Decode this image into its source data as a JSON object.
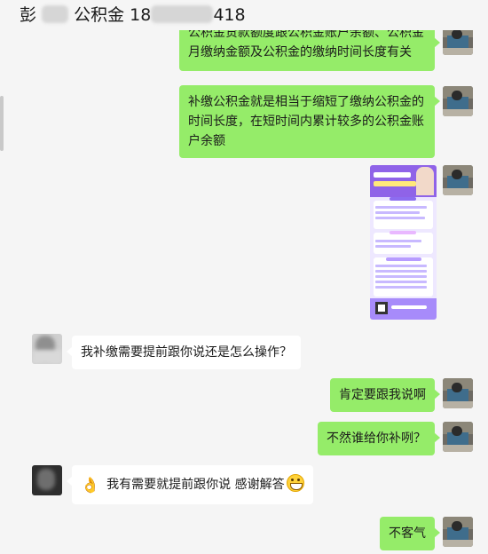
{
  "header": {
    "title_start": "彭",
    "title_middle": "公积金 18",
    "title_end": "418"
  },
  "messages": [
    {
      "side": "right",
      "type": "text",
      "text": "公积金贷款额度跟公积金账户余额、公积金月缴纳金额及公积金的缴纳时间长度有关"
    },
    {
      "side": "right",
      "type": "text",
      "text": "补缴公积金就是相当于缩短了缴纳公积金的时间长度，在短时间内累计较多的公积金账户余额"
    },
    {
      "side": "right",
      "type": "image",
      "icon": "purple-info-poster"
    },
    {
      "side": "left",
      "type": "text",
      "text": "我补缴需要提前跟你说还是怎么操作？"
    },
    {
      "side": "right",
      "type": "text",
      "text": "肯定要跟我说啊"
    },
    {
      "side": "right",
      "type": "text",
      "text": "不然谁给你补咧？"
    },
    {
      "side": "left",
      "type": "text",
      "text": "我有需要就提前跟你说 感谢解答",
      "emoji_before": "👌",
      "emoji_after": "grinning-face"
    },
    {
      "side": "right",
      "type": "text",
      "text": "不客气"
    }
  ],
  "colors": {
    "background": "#f5f5f5",
    "sent_bubble": "#95ec69",
    "received_bubble": "#ffffff",
    "poster_accent": "#8f63e8"
  }
}
